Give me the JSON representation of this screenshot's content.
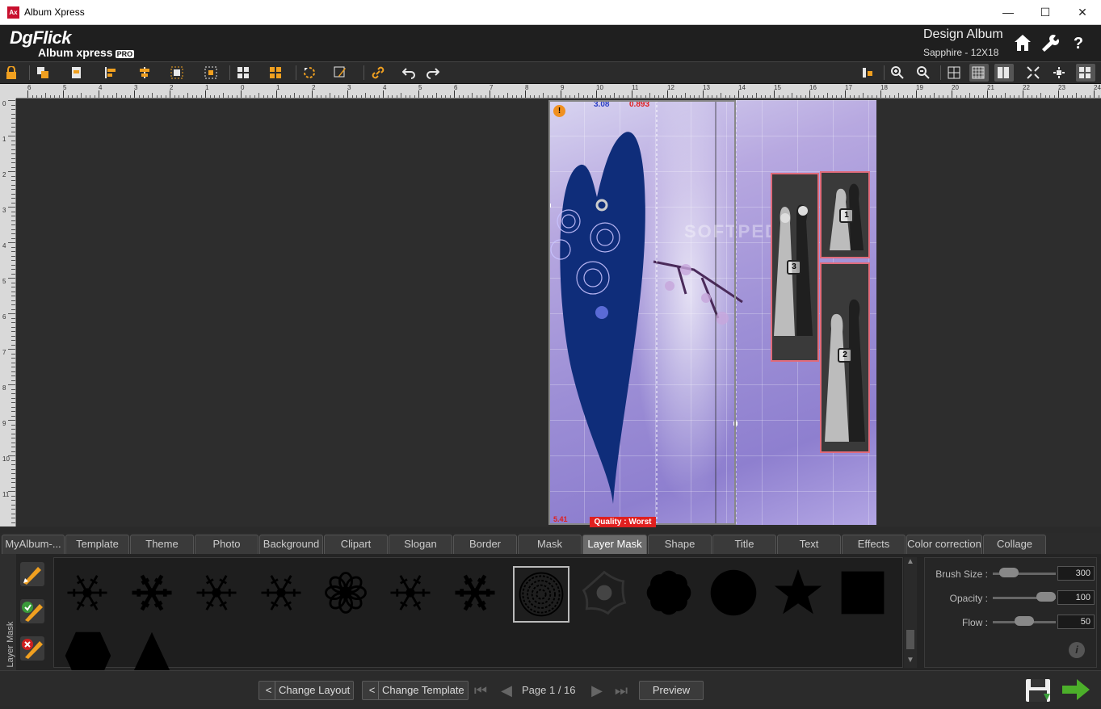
{
  "window": {
    "title": "Album Xpress",
    "app_icon": "Ax",
    "minimize": "—",
    "maximize": "☐",
    "close": "✕"
  },
  "header": {
    "logo_main": "DgFlick",
    "logo_sub": "Album xpress",
    "logo_pro": "PRO",
    "section_title": "Design Album",
    "album_info": "Sapphire - 12X18",
    "icons": [
      "home-icon",
      "wrench-icon",
      "help-icon"
    ],
    "help_label": "?"
  },
  "toolbar": {
    "colors": {
      "accent": "#f0a020",
      "icon_fg": "#e8e8e8"
    }
  },
  "ruler": {
    "h_labels": [
      "6",
      "5",
      "4",
      "3",
      "2",
      "1",
      "0",
      "1",
      "2",
      "3",
      "4",
      "5",
      "6",
      "7",
      "8",
      "9",
      "10",
      "11",
      "12",
      "13",
      "14",
      "15",
      "16",
      "17",
      "18",
      "19",
      "20",
      "21",
      "22",
      "23",
      "24"
    ],
    "v_labels": [
      "0",
      "1",
      "2",
      "3",
      "4",
      "5",
      "6",
      "7",
      "8",
      "9",
      "10",
      "11"
    ]
  },
  "canvas": {
    "dim_blue": "3.08",
    "dim_red": "0.893",
    "coord_red": "5.41",
    "quality": "Quality : Worst",
    "warning_badge": "!",
    "watermark": "SOFTPEDIA",
    "photo_numbers": [
      "3",
      "1",
      "2"
    ]
  },
  "tabs": [
    {
      "label": "MyAlbum-...",
      "active": false
    },
    {
      "label": "Template",
      "active": false
    },
    {
      "label": "Theme",
      "active": false
    },
    {
      "label": "Photo",
      "active": false
    },
    {
      "label": "Background",
      "active": false
    },
    {
      "label": "Clipart",
      "active": false
    },
    {
      "label": "Slogan",
      "active": false
    },
    {
      "label": "Border",
      "active": false
    },
    {
      "label": "Mask",
      "active": false
    },
    {
      "label": "Layer Mask",
      "active": true
    },
    {
      "label": "Shape",
      "active": false
    },
    {
      "label": "Title",
      "active": false
    },
    {
      "label": "Text",
      "active": false
    },
    {
      "label": "Effects",
      "active": false
    },
    {
      "label": "Color correction",
      "active": false
    },
    {
      "label": "Collage",
      "active": false
    }
  ],
  "panel": {
    "vertical_label": "Layer Mask",
    "brush_size_label": "Brush Size :",
    "brush_size": "300",
    "opacity_label": "Opacity :",
    "opacity": "100",
    "flow_label": "Flow :",
    "flow": "50",
    "brush_size_level": 0.15,
    "opacity_level": 1.0,
    "flow_level": 0.5,
    "info_icon": "i"
  },
  "masks": [
    "snowflake-1",
    "snowflake-2",
    "snowflake-3",
    "snowflake-4",
    "flower",
    "snowflake-5",
    "snowflake-6",
    "mandala",
    "grunge-flower",
    "fuzzy-flower",
    "circle",
    "star",
    "square",
    "hexagon",
    "triangle"
  ],
  "bottom": {
    "change_layout": "Change Layout",
    "change_template": "Change Template",
    "page_label": "Page 1 / 16",
    "preview": "Preview",
    "lt": "<"
  }
}
